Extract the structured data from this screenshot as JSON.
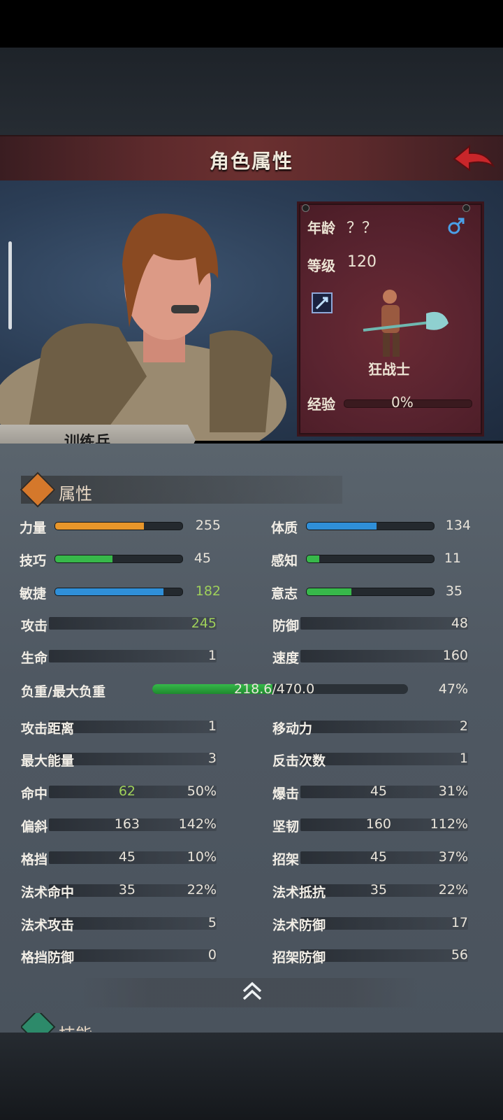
{
  "header": {
    "title": "角色属性",
    "back_icon": "back-arrow-icon"
  },
  "character": {
    "class_title": "训练兵",
    "age_label": "年龄",
    "age_value": "？？",
    "level_label": "等级",
    "level_value": "120",
    "job_name": "狂战士",
    "exp_label": "经验",
    "exp_value": "0%",
    "gender_icon": "male-icon"
  },
  "attributes_section": {
    "title": "属性"
  },
  "primary_stats": [
    {
      "label": "力量",
      "value": "255",
      "fill": 0.7,
      "color": "#e8962a"
    },
    {
      "label": "体质",
      "value": "134",
      "fill": 0.55,
      "color": "#2f8fd8"
    },
    {
      "label": "技巧",
      "value": "45",
      "fill": 0.45,
      "color": "#37b84a"
    },
    {
      "label": "感知",
      "value": "11",
      "fill": 0.1,
      "color": "#37b84a"
    },
    {
      "label": "敏捷",
      "value": "182",
      "fill": 0.85,
      "color": "#2f8fd8"
    },
    {
      "label": "意志",
      "value": "35",
      "fill": 0.35,
      "color": "#37b84a"
    }
  ],
  "combat": {
    "attack_label": "攻击",
    "attack_value": "245",
    "defense_label": "防御",
    "defense_value": "48",
    "hp_label": "生命",
    "hp_value": "1",
    "speed_label": "速度",
    "speed_value": "160",
    "weight_label": "负重/最大负重",
    "weight_value": "218.6/470.0",
    "weight_percent": "47%",
    "weight_fill": 0.47
  },
  "secondary": {
    "range_label": "攻击距离",
    "range_value": "1",
    "move_label": "移动力",
    "move_value": "2",
    "energy_label": "最大能量",
    "energy_value": "3",
    "counter_label": "反击次数",
    "counter_value": "1",
    "hit_label": "命中",
    "hit_value": "62",
    "hit_pct": "50%",
    "crit_label": "爆击",
    "crit_value": "45",
    "crit_pct": "31%",
    "deflect_label": "偏斜",
    "deflect_value": "163",
    "deflect_pct": "142%",
    "tough_label": "坚韧",
    "tough_value": "160",
    "tough_pct": "112%",
    "block_label": "格挡",
    "block_value": "45",
    "block_pct": "10%",
    "parry_label": "招架",
    "parry_value": "45",
    "parry_pct": "37%",
    "spellhit_label": "法术命中",
    "spellhit_value": "35",
    "spellhit_pct": "22%",
    "spellres_label": "法术抵抗",
    "spellres_value": "35",
    "spellres_pct": "22%",
    "spellatk_label": "法术攻击",
    "spellatk_value": "5",
    "spelldef_label": "法术防御",
    "spelldef_value": "17",
    "blockdef_label": "格挡防御",
    "blockdef_value": "0",
    "parrydef_label": "招架防御",
    "parrydef_value": "56"
  },
  "skills_section": {
    "title": "技能"
  }
}
